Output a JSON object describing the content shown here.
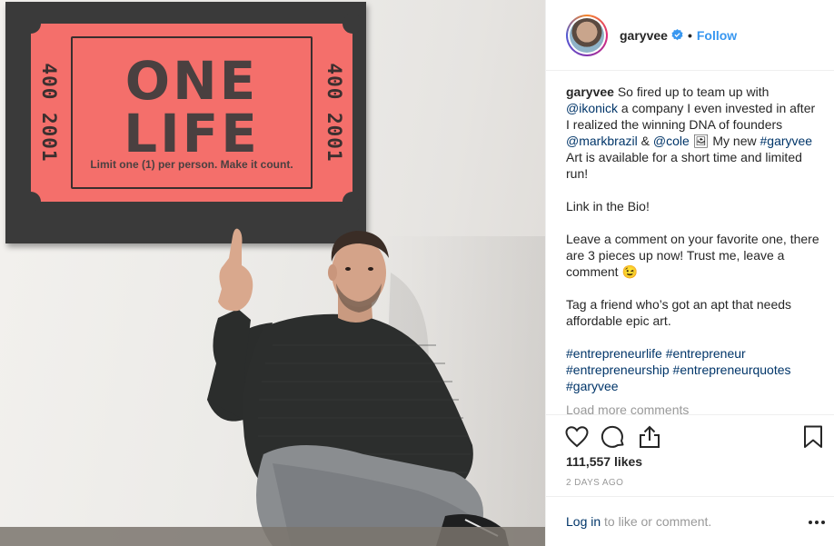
{
  "photo": {
    "poster": {
      "side_number_left": "400 2001",
      "side_number_right": "400 2001",
      "line1": "ONE",
      "line2": "LIFE",
      "fine_print": "Limit one (1) per person. Make it count."
    }
  },
  "header": {
    "username": "garyvee",
    "separator": "•",
    "follow_label": "Follow"
  },
  "caption": {
    "username": "garyvee",
    "text_1": " So fired up to team up with ",
    "mention_1": "@ikonick",
    "text_2": " a company I even invested in after I realized the winning DNA of founders ",
    "mention_2": "@markbrazil",
    "text_3": " & ",
    "mention_3": "@cole",
    "text_4": " 🖼 My new ",
    "hashtag_0": "#garyvee",
    "text_5": " Art is available for a short time and limited run!",
    "paragraph_2": "Link in the Bio!",
    "paragraph_3": "Leave a comment on your favorite one, there are 3 pieces up now! Trust me, leave a comment 😉",
    "paragraph_4": "Tag a friend who’s got an apt that needs affordable epic art.",
    "hashtags": [
      "#entrepreneurlife",
      "#entrepreneur",
      "#entrepreneurship",
      "#entrepreneurquotes",
      "#garyvee"
    ]
  },
  "comments": {
    "load_more_label": "Load more comments"
  },
  "stats": {
    "likes": "111,557 likes",
    "posted": "2 DAYS AGO"
  },
  "footer": {
    "login_link": "Log in",
    "login_rest": " to like or comment."
  },
  "icons": {
    "like": "heart-outline",
    "comment": "speech-bubble-outline",
    "share": "share-upload",
    "save": "bookmark-outline",
    "more": "horizontal-ellipsis"
  },
  "colors": {
    "link_blue": "#3897f0",
    "hashtag_blue": "#003569",
    "muted_gray": "#999999",
    "poster_red": "#f46f6b"
  }
}
